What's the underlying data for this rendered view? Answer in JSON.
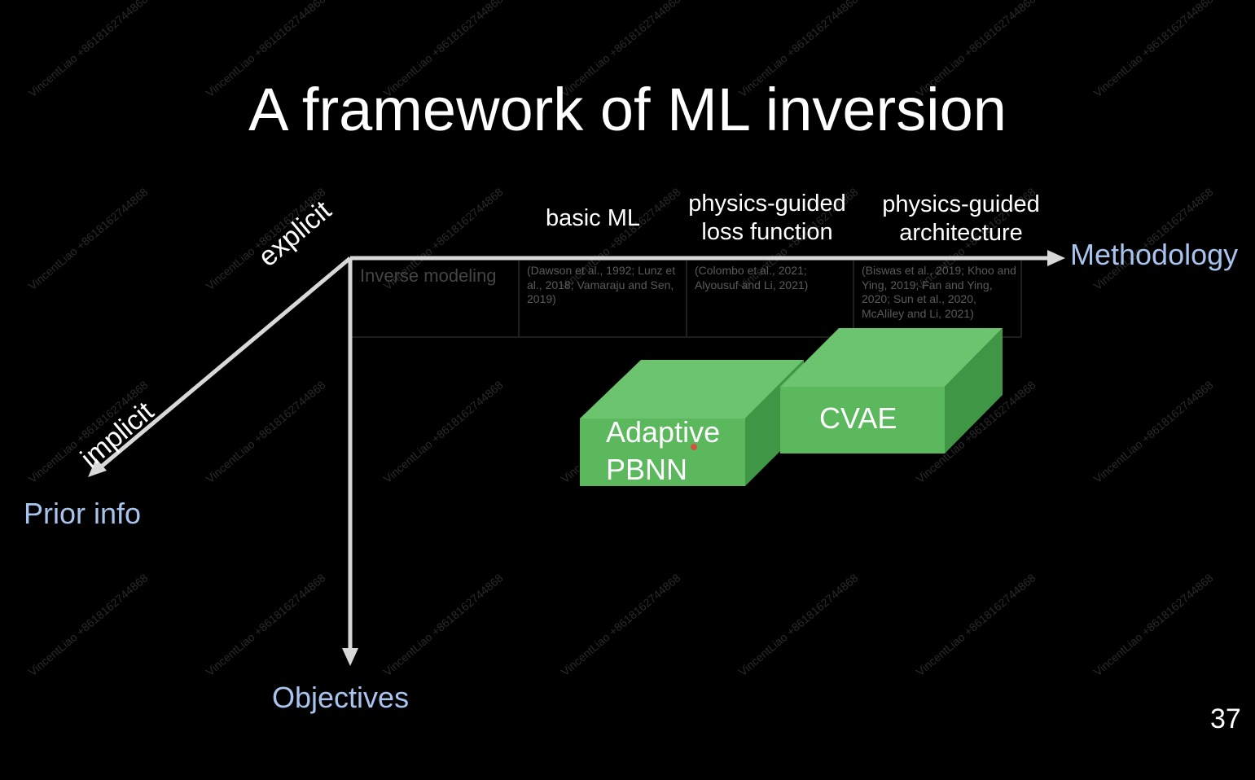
{
  "slide": {
    "title": "A framework of ML inversion",
    "page_number": "37"
  },
  "axes": {
    "x_label": "Methodology",
    "y_label": "Objectives",
    "z_label": "Prior info",
    "z_explicit": "explicit",
    "z_implicit": "implicit"
  },
  "columns": [
    {
      "line1": "basic ML",
      "line2": ""
    },
    {
      "line1": "physics-guided",
      "line2": "loss function"
    },
    {
      "line1": "physics-guided",
      "line2": "architecture"
    }
  ],
  "table": {
    "row_label": "Inverse modeling",
    "refs": [
      "(Dawson et al., 1992; Lunz et al., 2018; Vamaraju and Sen, 2019)",
      "(Colombo et al., 2021; Alyousuf and Li, 2021)",
      "(Biswas et al., 2019; Khoo and Ying, 2019; Fan and Ying, 2020; Sun et al., 2020, McAliley and Li, 2021)"
    ]
  },
  "boxes": [
    {
      "line1": "Adaptive",
      "line2": "PBNN",
      "color": "#5bb85d"
    },
    {
      "line1": "CVAE",
      "line2": "",
      "color": "#5bb85d"
    }
  ],
  "watermark": "VincentLiao +8618162744868",
  "colors": {
    "axis": "#d8d8d8",
    "axis_label": "#a8c4ee",
    "box_front": "#5bb85d",
    "box_top": "#6cc46e",
    "box_side": "#3f9645"
  }
}
